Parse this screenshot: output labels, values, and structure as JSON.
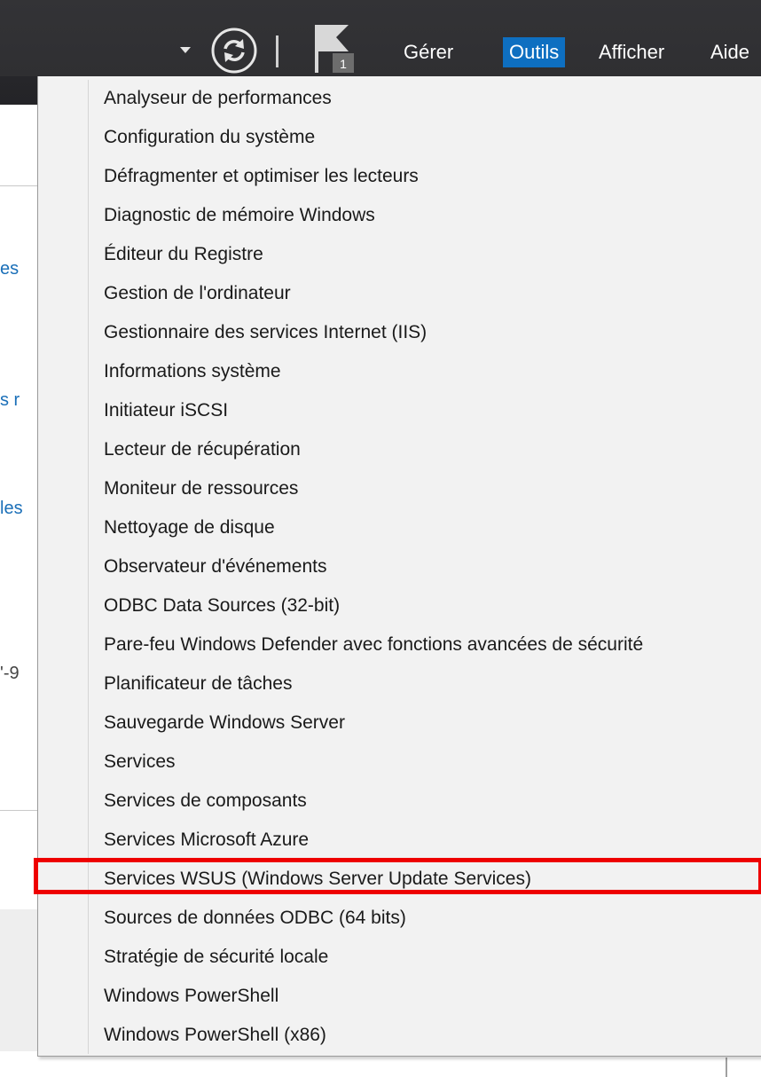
{
  "toolbar": {
    "dropdown_icon": "chevron-down-icon",
    "refresh_icon": "refresh-icon",
    "flag_icon": "notification-flag-icon",
    "flag_badge": "1"
  },
  "menubar": {
    "items": [
      {
        "label": "Gérer"
      },
      {
        "label": "Outils",
        "active": true
      },
      {
        "label": "Afficher"
      },
      {
        "label": "Aide"
      }
    ],
    "active_color": "#0e6fc1"
  },
  "background_fragments": [
    "es",
    "s r",
    "les",
    "'-9"
  ],
  "tools_menu": {
    "items": [
      "Analyseur de performances",
      "Configuration du système",
      "Défragmenter et optimiser les lecteurs",
      "Diagnostic de mémoire Windows",
      "Éditeur du Registre",
      "Gestion de l'ordinateur",
      "Gestionnaire des services Internet (IIS)",
      "Informations système",
      "Initiateur iSCSI",
      "Lecteur de récupération",
      "Moniteur de ressources",
      "Nettoyage de disque",
      "Observateur d'événements",
      "ODBC Data Sources (32-bit)",
      "Pare-feu Windows Defender avec fonctions avancées de sécurité",
      "Planificateur de tâches",
      "Sauvegarde Windows Server",
      "Services",
      "Services de composants",
      "Services Microsoft Azure",
      "Services WSUS (Windows Server Update Services)",
      "Sources de données ODBC (64 bits)",
      "Stratégie de sécurité locale",
      "Windows PowerShell",
      "Windows PowerShell (x86)"
    ],
    "highlighted_item": "Services WSUS (Windows Server Update Services)",
    "highlight_color": "#ee0000"
  }
}
